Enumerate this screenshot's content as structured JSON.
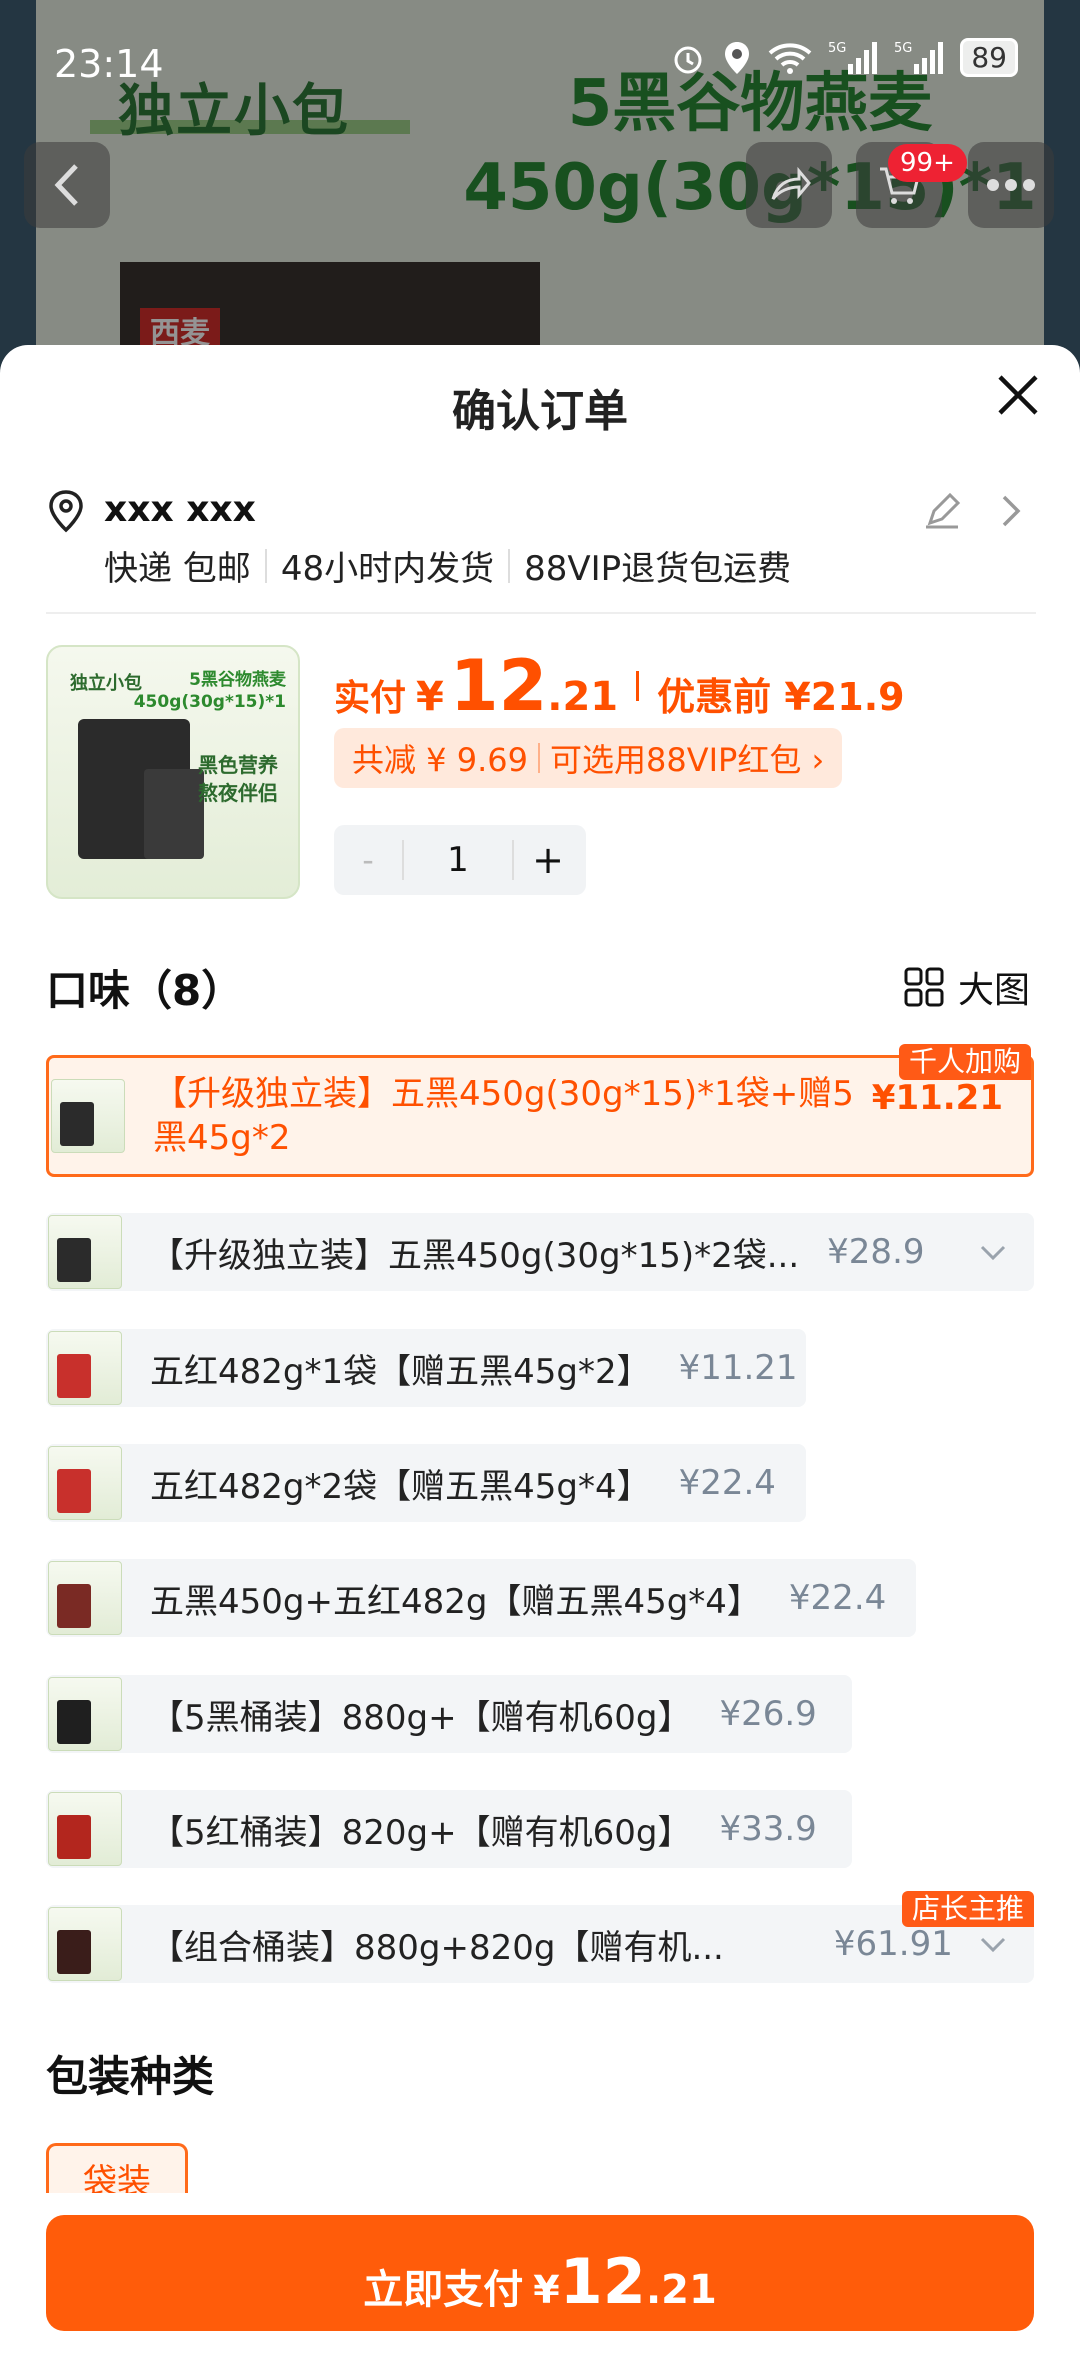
{
  "status": {
    "time": "23:14",
    "battery": "89",
    "network": "5G"
  },
  "background": {
    "small_title": "独立小包",
    "big_title_line1": "5黑谷物燕麦",
    "big_title_line2": "450g(30g*15)*1",
    "product_label": "西麦",
    "cart_badge": "99+"
  },
  "sheet": {
    "title": "确认订单",
    "address": {
      "name": "xxx xxx"
    },
    "shipping": [
      "快递 包邮",
      "48小时内发货",
      "88VIP退货包运费"
    ],
    "product_image": {
      "brand_text": "独立小包",
      "title_line1": "5黑谷物燕麦",
      "title_line2": "450g(30g*15)*1",
      "slogan_line1": "黑色营养",
      "slogan_line2": "熬夜伴侣"
    },
    "price": {
      "label": "实付",
      "currency": "¥",
      "integer": "12",
      "decimal": ".21",
      "before_label": "优惠前 ¥21.9"
    },
    "discount": {
      "saved": "共减 ¥ 9.69",
      "vip": "可选用88VIP红包 ›"
    },
    "quantity": {
      "minus": "-",
      "value": "1",
      "plus": "+"
    },
    "flavor_section": {
      "title": "口味（8）",
      "big_image_label": "大图"
    },
    "options": [
      {
        "text": "【升级独立装】五黑450g(30g*15)*1袋+赠5",
        "text2": "黑45g*2",
        "price": "¥11.21",
        "selected": true,
        "tag": "千人加购",
        "thumb_color": "#2b2b2b"
      },
      {
        "text": "【升级独立装】五黑450g(30g*15)*2袋...",
        "price": "¥28.9",
        "dropdown": true,
        "thumb_color": "#2b2b2b"
      },
      {
        "text": "五红482g*1袋【赠五黑45g*2】",
        "price": "¥11.21",
        "thumb_color": "#c8302c"
      },
      {
        "text": "五红482g*2袋【赠五黑45g*4】",
        "price": "¥22.4",
        "thumb_color": "#c8302c"
      },
      {
        "text": "五黑450g+五红482g【赠五黑45g*4】",
        "price": "¥22.4",
        "thumb_color": "#7a2a24"
      },
      {
        "text": "【5黑桶装】880g+【赠有机60g】",
        "price": "¥26.9",
        "thumb_color": "#1f1f1f"
      },
      {
        "text": "【5红桶装】820g+【赠有机60g】",
        "price": "¥33.9",
        "thumb_color": "#b3261e"
      },
      {
        "text": "【组合桶装】880g+820g【赠有机...",
        "price": "¥61.91",
        "dropdown": true,
        "tag": "店长主推",
        "thumb_color": "#3a1d1a"
      }
    ],
    "package_section": {
      "title": "包装种类",
      "chip": "袋装"
    },
    "pay_button": {
      "label": "立即支付",
      "currency": "¥",
      "integer": "12",
      "decimal": ".21"
    }
  },
  "colors": {
    "accent": "#ff5000",
    "button": "#ff5c0a",
    "tag": "#ff5a16"
  }
}
